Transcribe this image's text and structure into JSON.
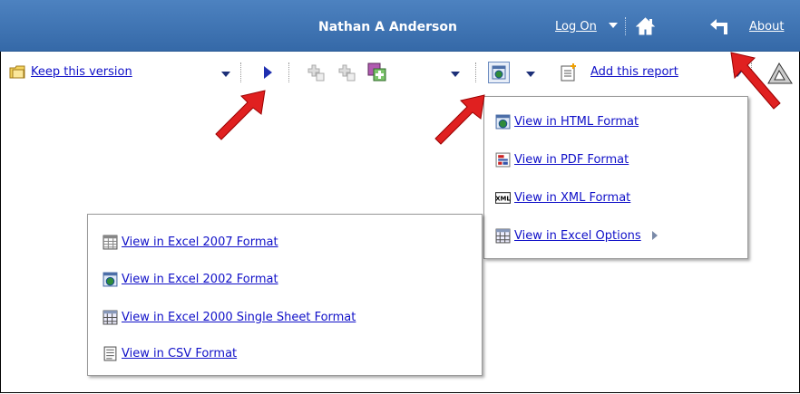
{
  "header": {
    "user_name": "Nathan A Anderson",
    "log_on_label": "Log On",
    "about_label": "About"
  },
  "toolbar": {
    "keep_version_label": "Keep this version",
    "add_report_label": "Add this report"
  },
  "format_menu": {
    "items": [
      {
        "label": "View in HTML Format",
        "icon": "html-format-icon"
      },
      {
        "label": "View in PDF Format",
        "icon": "pdf-format-icon"
      },
      {
        "label": "View in XML Format",
        "icon": "xml-format-icon"
      },
      {
        "label": "View in Excel Options",
        "icon": "excel-options-icon"
      }
    ]
  },
  "excel_menu": {
    "items": [
      {
        "label": "View in Excel 2007 Format",
        "icon": "excel-2007-icon"
      },
      {
        "label": "View in Excel 2002 Format",
        "icon": "excel-2002-icon"
      },
      {
        "label": "View in Excel 2000 Single Sheet Format",
        "icon": "excel-2000-icon"
      },
      {
        "label": "View in CSV Format",
        "icon": "csv-icon"
      }
    ]
  },
  "colors": {
    "header_bg": "#3d74b5",
    "link": "#1010c8",
    "callout_arrow": "#e02020"
  }
}
